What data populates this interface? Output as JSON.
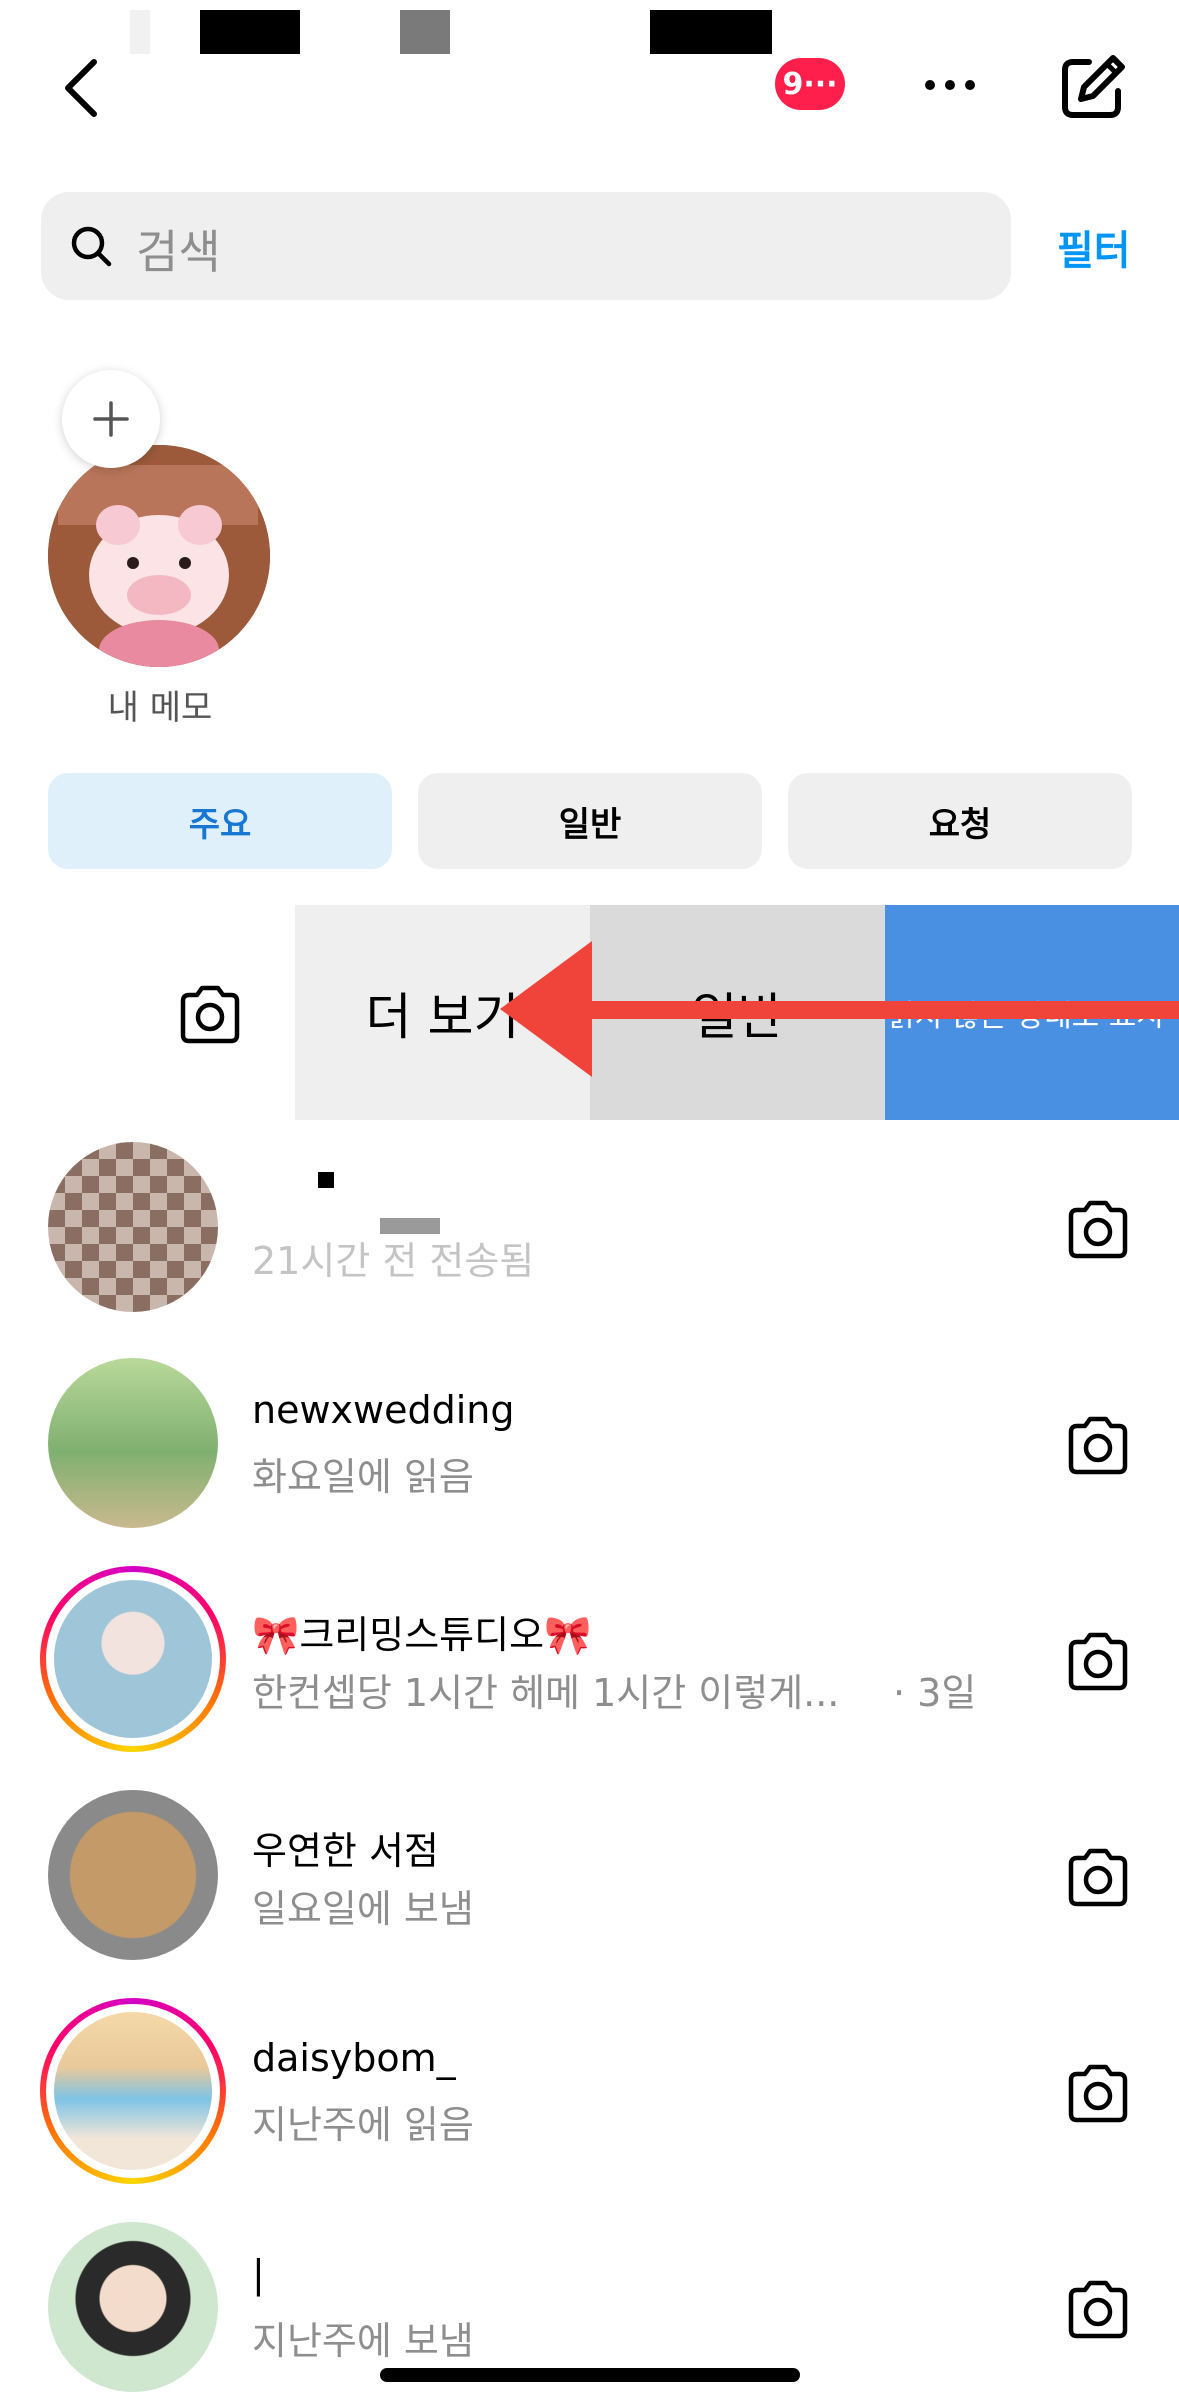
{
  "header": {
    "notification_badge": "9···",
    "back_icon": "chevron-left-icon",
    "more_icon": "more-horizontal-icon",
    "compose_icon": "compose-icon"
  },
  "search": {
    "placeholder": "검색",
    "filter_label": "필터"
  },
  "note": {
    "label": "내 메모"
  },
  "tabs": [
    {
      "label": "주요",
      "active": true
    },
    {
      "label": "일반",
      "active": false
    },
    {
      "label": "요청",
      "active": false
    }
  ],
  "swipe_actions": {
    "more_label": "더 보기",
    "general_label": "일반",
    "unread_label": "읽지 않은 상태로 표시"
  },
  "chats": [
    {
      "name": "",
      "sub": "21시간 전 전송됨",
      "time": "",
      "ring": false
    },
    {
      "name": "newxwedding",
      "sub": "화요일에 읽음",
      "time": "",
      "ring": false
    },
    {
      "name": "🎀크리밍스튜디오🎀",
      "sub": "한컨셉당 1시간 헤메 1시간 이렇게...",
      "time": "· 3일",
      "ring": true
    },
    {
      "name": "우연한 서점",
      "sub": "일요일에 보냄",
      "time": "",
      "ring": false
    },
    {
      "name": "daisybom_",
      "sub": "지난주에 읽음",
      "time": "",
      "ring": true
    },
    {
      "name": "|",
      "sub": "지난주에 보냄",
      "time": "",
      "ring": false
    }
  ],
  "colors": {
    "accent": "#0095f6",
    "badge": "#ff1f4c",
    "unread_action": "#4a90e2",
    "arrow": "#f0433a"
  }
}
